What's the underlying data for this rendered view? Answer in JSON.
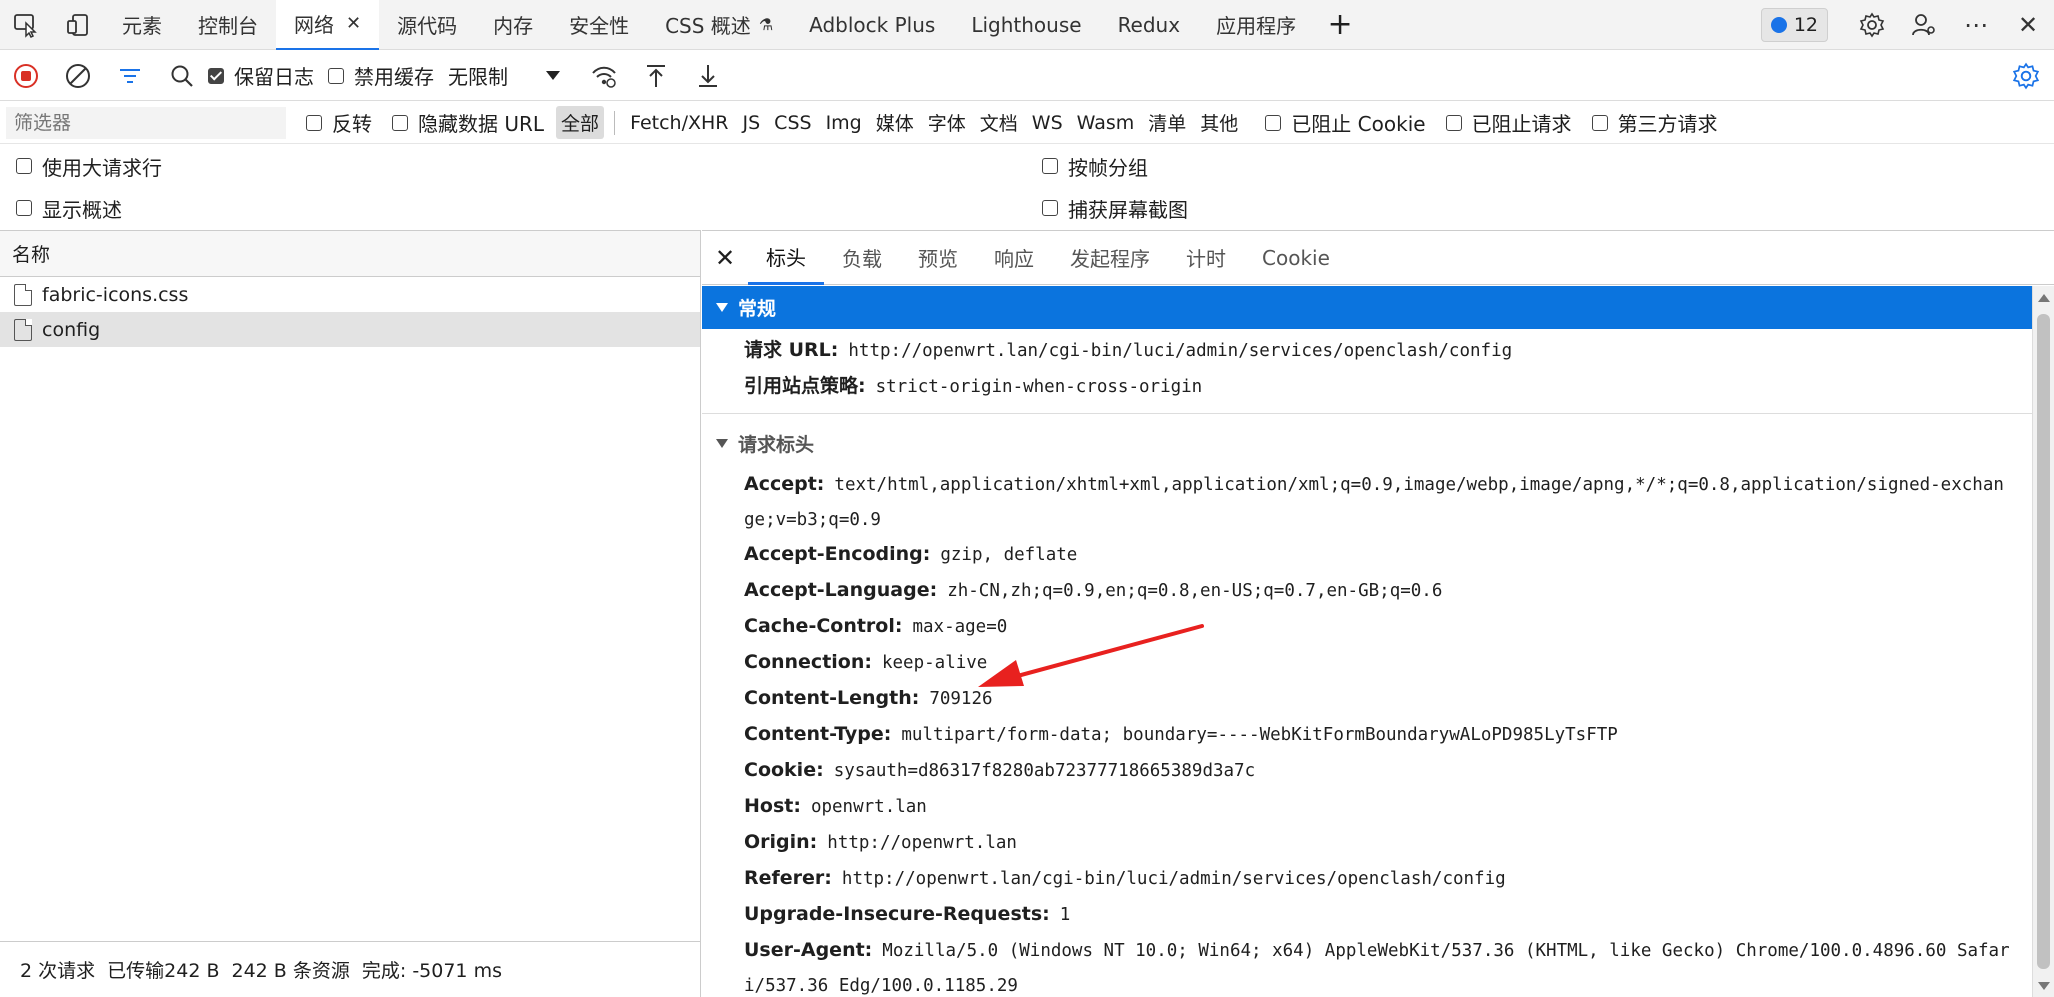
{
  "tabbar": {
    "tabs": [
      {
        "label": "元素"
      },
      {
        "label": "控制台"
      },
      {
        "label": "网络",
        "active": true
      },
      {
        "label": "源代码"
      },
      {
        "label": "内存"
      },
      {
        "label": "安全性"
      },
      {
        "label": "CSS 概述"
      },
      {
        "label": "Adblock Plus"
      },
      {
        "label": "Lighthouse"
      },
      {
        "label": "Redux"
      },
      {
        "label": "应用程序"
      }
    ],
    "issues_count": "12",
    "close_tab_glyph": "✕",
    "add_tab_glyph": "+",
    "more_glyph": "⋯",
    "close_glyph": "✕"
  },
  "toolbar": {
    "preserve_log": "保留日志",
    "disable_cache": "禁用缓存",
    "throttle": "无限制"
  },
  "filter": {
    "placeholder": "筛选器",
    "invert": "反转",
    "hide_data_url": "隐藏数据 URL",
    "types": [
      "全部",
      "Fetch/XHR",
      "JS",
      "CSS",
      "Img",
      "媒体",
      "字体",
      "文档",
      "WS",
      "Wasm",
      "清单",
      "其他"
    ],
    "blocked_cookies": "已阻止 Cookie",
    "blocked_requests": "已阻止请求",
    "third_party": "第三方请求"
  },
  "options": {
    "large_rows": "使用大请求行",
    "group_by_frame": "按帧分组",
    "show_overview": "显示概述",
    "capture_screenshots": "捕获屏幕截图"
  },
  "list": {
    "header": "名称",
    "rows": [
      "fabric-icons.css",
      "config"
    ]
  },
  "status": {
    "requests": "2 次请求",
    "transferred": "已传输242 B",
    "resources": "242 B 条资源",
    "finish": "完成: -5071 ms"
  },
  "details": {
    "tabs": [
      "标头",
      "负载",
      "预览",
      "响应",
      "发起程序",
      "计时",
      "Cookie"
    ],
    "general_title": "常规",
    "general": [
      {
        "k": "请求 URL:",
        "v": "http://openwrt.lan/cgi-bin/luci/admin/services/openclash/config"
      },
      {
        "k": "引用站点策略:",
        "v": "strict-origin-when-cross-origin"
      }
    ],
    "req_headers_title": "请求标头",
    "headers": [
      {
        "k": "Accept:",
        "v": "text/html,application/xhtml+xml,application/xml;q=0.9,image/webp,image/apng,*/*;q=0.8,application/signed-exchange;v=b3;q=0.9"
      },
      {
        "k": "Accept-Encoding:",
        "v": "gzip, deflate"
      },
      {
        "k": "Accept-Language:",
        "v": "zh-CN,zh;q=0.9,en;q=0.8,en-US;q=0.7,en-GB;q=0.6"
      },
      {
        "k": "Cache-Control:",
        "v": "max-age=0"
      },
      {
        "k": "Connection:",
        "v": "keep-alive"
      },
      {
        "k": "Content-Length:",
        "v": "709126"
      },
      {
        "k": "Content-Type:",
        "v": "multipart/form-data; boundary=----WebKitFormBoundarywALoPD985LyTsFTP"
      },
      {
        "k": "Cookie:",
        "v": "sysauth=d86317f8280ab72377718665389d3a7c"
      },
      {
        "k": "Host:",
        "v": "openwrt.lan"
      },
      {
        "k": "Origin:",
        "v": "http://openwrt.lan"
      },
      {
        "k": "Referer:",
        "v": "http://openwrt.lan/cgi-bin/luci/admin/services/openclash/config"
      },
      {
        "k": "Upgrade-Insecure-Requests:",
        "v": "1"
      },
      {
        "k": "User-Agent:",
        "v": "Mozilla/5.0 (Windows NT 10.0; Win64; x64) AppleWebKit/537.36 (KHTML, like Gecko) Chrome/100.0.4896.60 Safari/537.36 Edg/100.0.1185.29"
      }
    ]
  },
  "colors": {
    "accent": "#1a73e8",
    "section_blue": "#0b74de",
    "record_red": "#d93025",
    "annotation_red": "#e8211f"
  }
}
